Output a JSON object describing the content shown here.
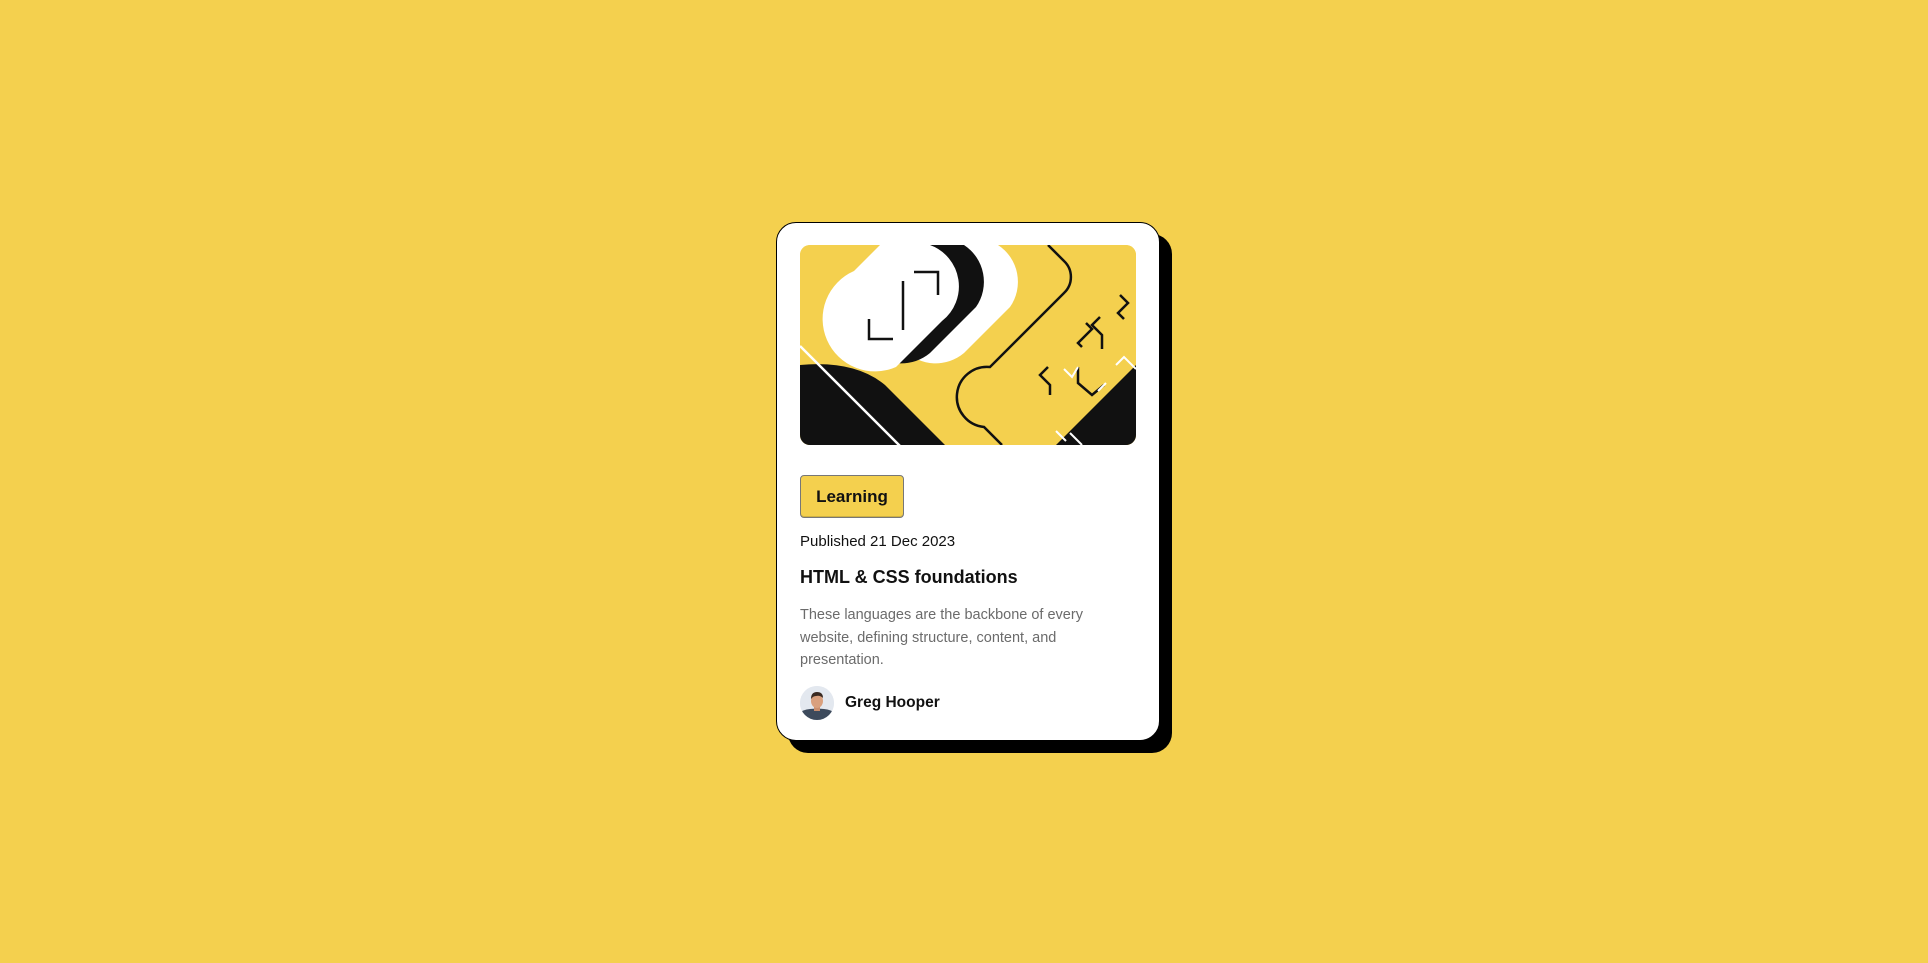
{
  "colors": {
    "background": "#F4D04E",
    "card": "#FFFFFF",
    "shadow": "#000000",
    "text": "#111111",
    "muted": "#6B6B6B"
  },
  "card": {
    "illustration_icon": "abstract-illustration",
    "tag": "Learning",
    "published": "Published 21 Dec 2023",
    "title": "HTML & CSS foundations",
    "excerpt": "These languages are the backbone of every website, defining structure, content, and presentation.",
    "author": {
      "name": "Greg Hooper",
      "avatar_icon": "avatar-icon"
    }
  }
}
